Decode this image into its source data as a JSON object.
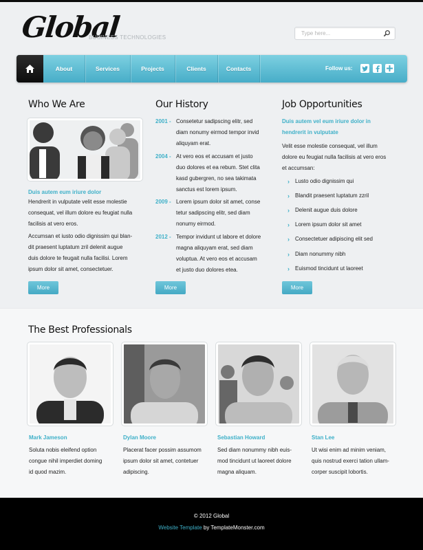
{
  "brand": {
    "logo": "Global",
    "tagline": "BUSINESS TECHNOLOGIES"
  },
  "search": {
    "placeholder": "Type here..."
  },
  "nav": {
    "items": [
      "About",
      "Services",
      "Projects",
      "Clients",
      "Contacts"
    ],
    "follow_label": "Follow us:",
    "social": [
      "twitter-icon",
      "facebook-icon",
      "plus-icon"
    ]
  },
  "colors": {
    "accent": "#3eb0c8",
    "nav_top": "#7dd0e1",
    "nav_bottom": "#47adc8",
    "footer": "#000000"
  },
  "who": {
    "title": "Who We Are",
    "subtitle": "Duis autem eum iriure dolor",
    "p1": "Hendrerit in vulputate velit esse molestie consequat, vel illum dolore eu feugiat nulla facilisis at vero eros.",
    "p2_lines": [
      "Accumsan et iusto odio dignissim qui blan-",
      "dit praesent luptatum zril delenit augue",
      "duis dolore te feugait nulla facilisi. Lorem",
      "ipsum dolor sit amet, consectetuer."
    ],
    "p1_lines": [
      "Hendrerit in vulputate velit esse molestie",
      "consequat, vel illum dolore eu feugiat nulla",
      "facilisis at vero eros."
    ],
    "more": "More"
  },
  "history": {
    "title": "Our History",
    "entries": [
      {
        "year": "2001 -",
        "lines": [
          "Consetetur sadipscing elitr, sed",
          "diam nonumy eirmod tempor invid",
          "aliquyam erat."
        ]
      },
      {
        "year": "2004 -",
        "lines": [
          "At vero eos et accusam et justo",
          "duo dolores et ea rebum. Stet clita",
          "kasd gubergren, no sea takimata",
          "sanctus est lorem ipsum."
        ]
      },
      {
        "year": "2009 -",
        "lines": [
          "Lorem ipsum dolor sit amet, conse",
          "tetur sadipscing elitr, sed diam",
          "nonumy eirmod."
        ]
      },
      {
        "year": "2012 -",
        "lines": [
          "Tempor invidunt ut labore et dolore",
          "magna aliquyam erat, sed diam",
          "voluptua. At vero eos et accusam",
          "et justo duo dolores etea."
        ]
      }
    ],
    "more": "More"
  },
  "jobs": {
    "title": "Job Opportunities",
    "subtitle_lines": [
      "Duis autem vel eum iriure dolor in",
      "hendrerit in vulputate"
    ],
    "intro_lines": [
      "Velit esse molestie consequat, vel illum",
      "dolore eu feugiat nulla facilisis at vero eros",
      "et accumsan:"
    ],
    "items": [
      "Lusto odio dignissim qui",
      "Blandit praesent luptatum zzril",
      "Delenit augue duis dolore",
      "Lorem ipsum dolor sit amet",
      "Consectetuer adipiscing elit sed",
      "Diam nonummy nibh",
      "Euismod tincidunt ut laoreet"
    ],
    "more": "More"
  },
  "professionals": {
    "title": "The Best Professionals",
    "people": [
      {
        "name": "Mark Jameson",
        "lines": [
          "Soluta nobis eleifend option",
          "congue nihil imperdiet doming",
          "id quod mazim."
        ]
      },
      {
        "name": "Dylan Moore",
        "lines": [
          "Placerat facer possim assumom",
          "ipsum dolor sit amet, contetuer",
          "adipiscing."
        ]
      },
      {
        "name": "Sebastian Howard",
        "lines": [
          "Sed diam nonummy nibh euis-",
          "mod tincidunt ut laoreet dolore",
          "magna aliquam."
        ]
      },
      {
        "name": "Stan Lee",
        "lines": [
          "Ut wisi enim ad minim veniam,",
          "quis nostrud exerci tation ullam-",
          "corper suscipit lobortis."
        ]
      }
    ]
  },
  "footer": {
    "copyright": "© 2012 Global",
    "link_text": "Website Template",
    "by_text": " by TemplateMonster.com"
  }
}
